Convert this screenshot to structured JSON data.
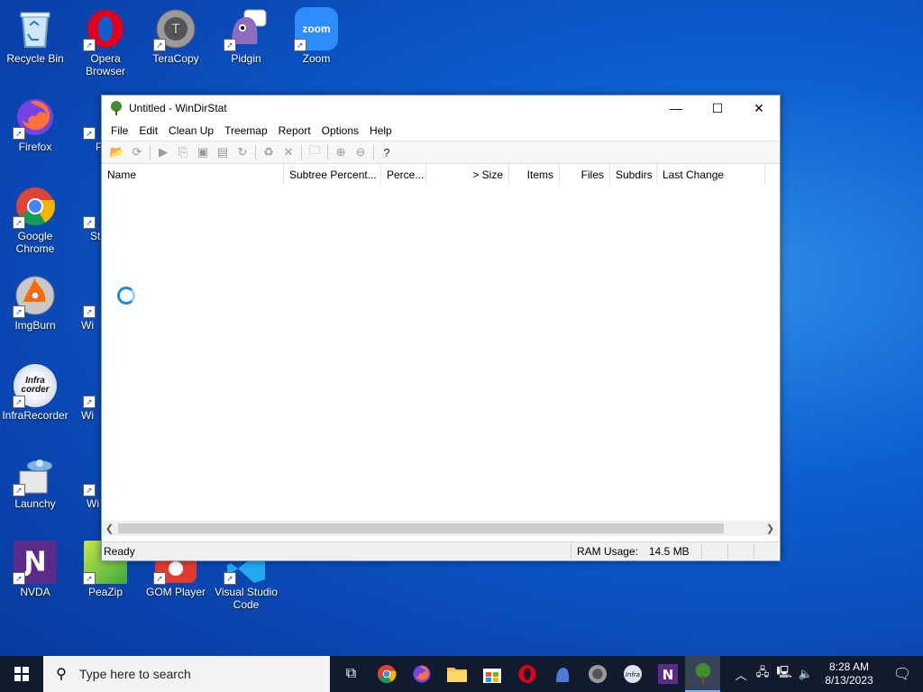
{
  "desktop": {
    "icons": [
      {
        "label": "Recycle Bin"
      },
      {
        "label": "Opera Browser"
      },
      {
        "label": "TeraCopy"
      },
      {
        "label": "Pidgin"
      },
      {
        "label": "Zoom"
      },
      {
        "label": "Firefox"
      },
      {
        "label": "Pu"
      },
      {
        "label": "Google Chrome"
      },
      {
        "label": "St"
      },
      {
        "label": "ImgBurn"
      },
      {
        "label": "Wi"
      },
      {
        "label": "InfraRecorder"
      },
      {
        "label": "Wi"
      },
      {
        "label": "Launchy"
      },
      {
        "label": "Wi"
      },
      {
        "label": "NVDA"
      },
      {
        "label": "PeaZip"
      },
      {
        "label": "GOM Player"
      },
      {
        "label": "Visual Studio Code"
      }
    ],
    "zoom_icon_text": "zoom",
    "infra_icon_text": "Infra corder"
  },
  "window": {
    "title": "Untitled - WinDirStat",
    "controls": {
      "minimize": "—",
      "maximize": "☐",
      "close": "✕"
    },
    "menu": [
      "File",
      "Edit",
      "Clean Up",
      "Treemap",
      "Report",
      "Options",
      "Help"
    ],
    "columns": [
      "Name",
      "Subtree Percent...",
      "Perce...",
      "> Size",
      "Items",
      "Files",
      "Subdirs",
      "Last Change"
    ],
    "status": {
      "left": "Ready",
      "ram_label": "RAM Usage:",
      "ram_value": "14.5 MB"
    }
  },
  "taskbar": {
    "search_placeholder": "Type here to search",
    "time": "8:28 AM",
    "date": "8/13/2023"
  },
  "colors": {
    "accent": "#1e88e5",
    "taskbar": "#121a2e",
    "desktop": "#0d5fd0"
  }
}
